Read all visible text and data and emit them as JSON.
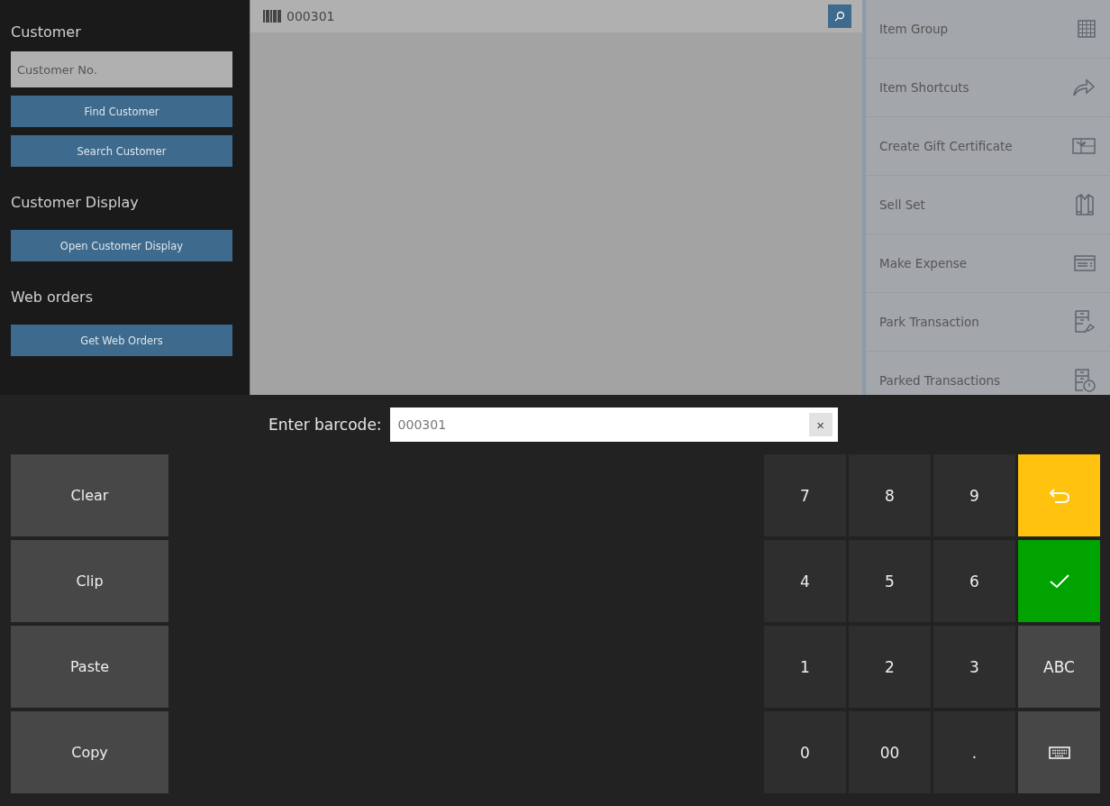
{
  "sidebar": {
    "sections": [
      {
        "title": "Customer",
        "field": {
          "placeholder": "Customer No."
        },
        "buttons": [
          "Find Customer",
          "Search Customer"
        ]
      },
      {
        "title": "Customer Display",
        "buttons": [
          "Open Customer Display"
        ]
      },
      {
        "title": "Web orders",
        "buttons": [
          "Get Web Orders"
        ]
      }
    ]
  },
  "scan_bar": {
    "value": "000301"
  },
  "actions": [
    {
      "label": "Item Group"
    },
    {
      "label": "Item Shortcuts"
    },
    {
      "label": "Create Gift Certificate"
    },
    {
      "label": "Sell Set"
    },
    {
      "label": "Make Expense"
    },
    {
      "label": "Park Transaction"
    },
    {
      "label": "Parked Transactions"
    }
  ],
  "barcode": {
    "label": "Enter barcode:",
    "value": "000301",
    "clear": "×"
  },
  "edit_buttons": [
    "Clear",
    "Clip",
    "Paste",
    "Copy"
  ],
  "keypad": [
    {
      "kind": "digit",
      "label": "7"
    },
    {
      "kind": "digit",
      "label": "8"
    },
    {
      "kind": "digit",
      "label": "9"
    },
    {
      "kind": "back"
    },
    {
      "kind": "digit",
      "label": "4"
    },
    {
      "kind": "digit",
      "label": "5"
    },
    {
      "kind": "digit",
      "label": "6"
    },
    {
      "kind": "enter"
    },
    {
      "kind": "digit",
      "label": "1"
    },
    {
      "kind": "digit",
      "label": "2"
    },
    {
      "kind": "digit",
      "label": "3"
    },
    {
      "kind": "mode",
      "label": "ABC"
    },
    {
      "kind": "digit",
      "label": "0"
    },
    {
      "kind": "digit",
      "label": "00"
    },
    {
      "kind": "digit",
      "label": "."
    },
    {
      "kind": "keyboard"
    }
  ]
}
